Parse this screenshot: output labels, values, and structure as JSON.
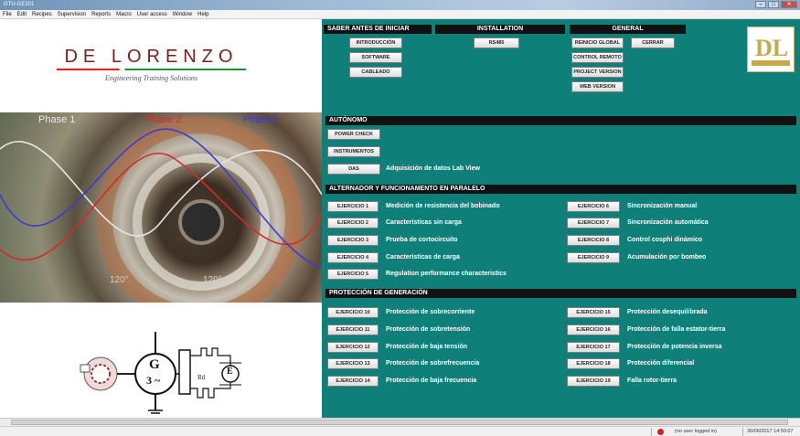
{
  "window": {
    "title": "GTU-GE101"
  },
  "menu": [
    "File",
    "Edit",
    "Recipes",
    "Supervision",
    "Reports",
    "Macro",
    "User access",
    "Window",
    "Help"
  ],
  "logo": {
    "name": "DE LORENZO",
    "tagline": "Engineering Training Solutions"
  },
  "photo": {
    "phases": [
      "Phase 1",
      "Phase 2",
      "Phase3"
    ],
    "angles": [
      "120°",
      "120°"
    ]
  },
  "diagram": {
    "gen_top": "G",
    "gen_bottom": "3 ~",
    "resistor": "Rd",
    "exciter": "E"
  },
  "sections": {
    "saber": "SABER ANTES DE INICIAR",
    "installation": "INSTALLATION",
    "general": "GENERAL",
    "autonomo": "AUTÓNOMO",
    "alternador": "ALTERNADOR Y FUNCIONAMENTO EN PARALELO",
    "proteccion": "PROTECCIÓN DE GENERACIÓN"
  },
  "buttons": {
    "introduccion": "INTRODUCCIÓN",
    "software": "SOFTWARE",
    "cableado": "CABLEADO",
    "rs485": "RS485",
    "reinicio": "REINICIO GLOBAL",
    "cerrar": "CERRAR",
    "control_remoto": "CONTROL REMOTO",
    "project_version": "PROJECT VERSION",
    "web_version": "WEB VERSION",
    "power_check": "POWER CHECK",
    "instrumentos": "INSTRUMENTOS",
    "das": "DAS"
  },
  "das_label": "Adquisición de datos Lab View",
  "alternador_left": [
    {
      "btn": "EJERCICIO 1",
      "label": "Medición de resistencia del bobinado"
    },
    {
      "btn": "EJERCICIO 2",
      "label": "Características sin carga"
    },
    {
      "btn": "EJERCICIO 3",
      "label": "Prueba de cortocircuito"
    },
    {
      "btn": "EJERCICIO 4",
      "label": "Características de carga"
    },
    {
      "btn": "EJERCICIO 5",
      "label": "Regulation performance characteristics"
    }
  ],
  "alternador_right": [
    {
      "btn": "EJERCICIO 6",
      "label": "Sincronización manual"
    },
    {
      "btn": "EJERCICIO 7",
      "label": "Sincronización automática"
    },
    {
      "btn": "EJERCICIO 8",
      "label": "Control cosphi dinámico"
    },
    {
      "btn": "EJERCICIO 9",
      "label": "Acumulación por bombeo"
    }
  ],
  "proteccion_left": [
    {
      "btn": "EJERCICIO 10",
      "label": "Protección de sobrecorriente"
    },
    {
      "btn": "EJERCICIO 11",
      "label": "Protección de sobretensión"
    },
    {
      "btn": "EJERCICIO 12",
      "label": "Protección de baja tensión"
    },
    {
      "btn": "EJERCICIO 13",
      "label": "Protección de sobrefrecuencia"
    },
    {
      "btn": "EJERCICIO 14",
      "label": "Protección de baja frecuencia"
    }
  ],
  "proteccion_right": [
    {
      "btn": "EJERCICIO 15",
      "label": "Protección desequilibrada"
    },
    {
      "btn": "EJERCICIO 16",
      "label": "Protección de falla estator-tierra"
    },
    {
      "btn": "EJERCICIO 17",
      "label": "Protección de potencia inversa"
    },
    {
      "btn": "EJERCICIO 18",
      "label": "Protección diferencial"
    },
    {
      "btn": "EJERCICIO 19",
      "label": "Falla rotor-tierra"
    }
  ],
  "status": {
    "user": "(no user logged in)",
    "datetime": "30/06/2017 14:50:07"
  },
  "colors": {
    "panel": "#0f7f7a",
    "header": "#111111",
    "phase1": "#e0e0e0",
    "phase2": "#d42a2a",
    "phase3": "#3a3ad8"
  }
}
